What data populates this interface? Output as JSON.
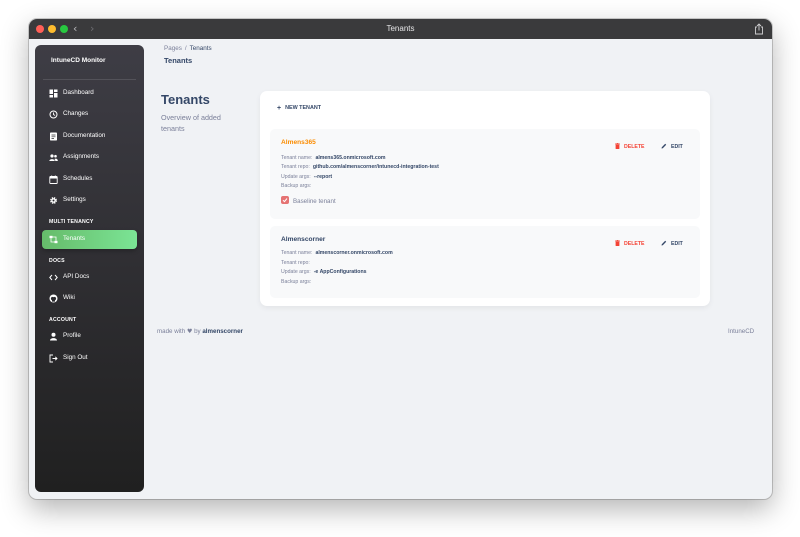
{
  "window": {
    "title": "Tenants"
  },
  "sidebar": {
    "brand": "IntuneCD Monitor",
    "items": [
      {
        "label": "Dashboard",
        "icon": "dashboard-icon"
      },
      {
        "label": "Changes",
        "icon": "changes-icon"
      },
      {
        "label": "Documentation",
        "icon": "documentation-icon"
      },
      {
        "label": "Assignments",
        "icon": "assignments-icon"
      },
      {
        "label": "Schedules",
        "icon": "calendar-icon"
      },
      {
        "label": "Settings",
        "icon": "gear-icon"
      }
    ],
    "multi_tenancy_header": "MULTI TENANCY",
    "tenants_item": {
      "label": "Tenants",
      "icon": "tenants-icon",
      "active": true
    },
    "docs_header": "DOCS",
    "docs_items": [
      {
        "label": "API Docs",
        "icon": "code-icon"
      },
      {
        "label": "Wiki",
        "icon": "github-icon"
      }
    ],
    "account_header": "ACCOUNT",
    "account_items": [
      {
        "label": "Profile",
        "icon": "person-icon"
      },
      {
        "label": "Sign Out",
        "icon": "logout-icon"
      }
    ]
  },
  "breadcrumb": {
    "root": "Pages",
    "separator": "/",
    "current": "Tenants"
  },
  "header": {
    "title": "Tenants"
  },
  "page": {
    "title": "Tenants",
    "subtitle": "Overview of added tenants"
  },
  "actions": {
    "new_tenant": "NEW TENANT",
    "delete": "DELETE",
    "edit": "EDIT"
  },
  "labels": {
    "tenant_name": "Tenant name:",
    "tenant_repo": "Tenant repo:",
    "update_args": "Update args:",
    "backup_args": "Backup args:"
  },
  "tenants": [
    {
      "name": "Almens365",
      "tenant_name": "almens365.onmicrosoft.com",
      "tenant_repo": "github.com/almenscorner/intunecd-integration-test",
      "update_args": "--report",
      "backup_args": "",
      "baseline": true,
      "baseline_label": "Baseline tenant"
    },
    {
      "name": "Almenscorner",
      "tenant_name": "almenscorner.onmicrosoft.com",
      "tenant_repo": "",
      "update_args": "-e AppConfigurations",
      "backup_args": "",
      "baseline": false
    }
  ],
  "footer": {
    "made_with": "made with",
    "by": "by",
    "author": "almenscorner",
    "right": "IntuneCD"
  },
  "colors": {
    "accent_green": "#66bb6a",
    "baseline_orange": "#fb8c00",
    "delete_red": "#f44335",
    "text_dark": "#344767",
    "text_muted": "#7b809a"
  }
}
